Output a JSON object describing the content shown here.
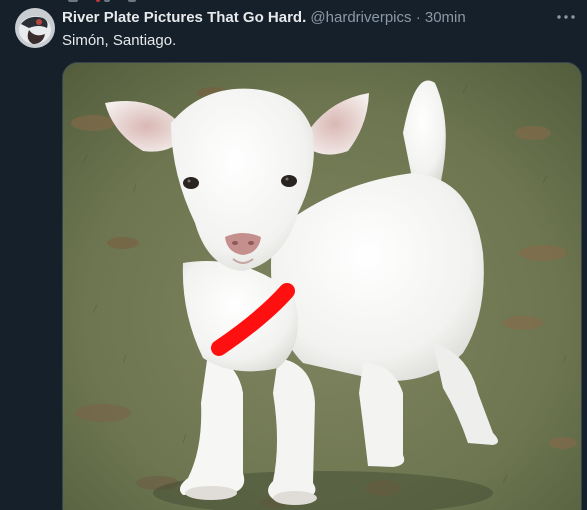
{
  "tweet": {
    "author": {
      "display_name": "River Plate Pictures That Go Hard.",
      "handle": "@hardriverpics"
    },
    "separator": "·",
    "timestamp": "30min",
    "text": "Simón, Santiago.",
    "media": {
      "subject": "white baby goat on grass",
      "icon": "goat-photo"
    }
  },
  "colors": {
    "background": "#15202b",
    "primary_text": "#e7e9ea",
    "secondary_text": "#8b98a5",
    "border": "#38444d",
    "annotation_stroke": "#ff1010"
  }
}
